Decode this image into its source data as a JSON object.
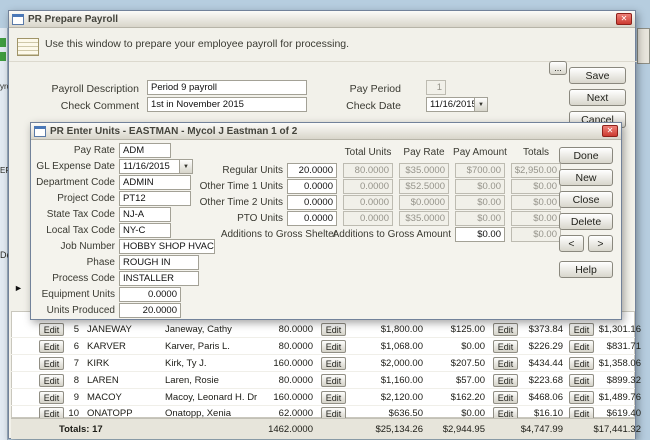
{
  "desktop": {
    "fragments": {
      "text1": "yroll",
      "text2": "EFTI",
      "text3": "Dep"
    }
  },
  "prepare_window": {
    "title": "PR Prepare Payroll",
    "instruction": "Use this window to prepare your employee payroll for processing.",
    "ellipsis_button": "...",
    "fields": {
      "payroll_description": {
        "label": "Payroll Description",
        "value": "Period 9 payroll"
      },
      "check_comment": {
        "label": "Check Comment",
        "value": "1st in November 2015"
      },
      "pay_period": {
        "label": "Pay Period",
        "value": "1"
      },
      "check_date": {
        "label": "Check Date",
        "value": "11/16/2015"
      }
    },
    "buttons": {
      "save": "Save",
      "next": "Next",
      "cancel": "Cancel"
    },
    "grid": {
      "edit_label": "Edit",
      "rows": [
        {
          "num": "5",
          "code": "JANEWAY",
          "name": "Janeway, Cathy",
          "hours": "80.0000",
          "amount1": "$1,800.00",
          "amount2": "$125.00",
          "amount3": "$373.84",
          "amount4": "$1,301.16"
        },
        {
          "num": "6",
          "code": "KARVER",
          "name": "Karver, Paris L.",
          "hours": "80.0000",
          "amount1": "$1,068.00",
          "amount2": "$0.00",
          "amount3": "$226.29",
          "amount4": "$831.71"
        },
        {
          "num": "7",
          "code": "KIRK",
          "name": "Kirk, Ty J.",
          "hours": "160.0000",
          "amount1": "$2,000.00",
          "amount2": "$207.50",
          "amount3": "$434.44",
          "amount4": "$1,358.06"
        },
        {
          "num": "8",
          "code": "LAREN",
          "name": "Laren, Rosie",
          "hours": "80.0000",
          "amount1": "$1,160.00",
          "amount2": "$57.00",
          "amount3": "$223.68",
          "amount4": "$899.32"
        },
        {
          "num": "9",
          "code": "MACOY",
          "name": "Macoy, Leonard H. Dr",
          "hours": "160.0000",
          "amount1": "$2,120.00",
          "amount2": "$162.20",
          "amount3": "$468.06",
          "amount4": "$1,489.76"
        },
        {
          "num": "10",
          "code": "ONATOPP",
          "name": "Onatopp, Xenia",
          "hours": "62.0000",
          "amount1": "$636.50",
          "amount2": "$0.00",
          "amount3": "$16.10",
          "amount4": "$619.40"
        }
      ],
      "totals": {
        "label": "Totals: 17",
        "hours": "1462.0000",
        "amount1": "$25,134.26",
        "amount2": "$2,944.95",
        "amount3": "$4,747.99",
        "amount4": "$17,441.32"
      }
    }
  },
  "units_dialog": {
    "title": "PR Enter Units - EASTMAN - Mycol J Eastman 1 of 2",
    "left_fields": {
      "pay_rate": {
        "label": "Pay Rate",
        "value": "ADM"
      },
      "gl_expense_date": {
        "label": "GL Expense Date",
        "value": "11/16/2015"
      },
      "department_code": {
        "label": "Department Code",
        "value": "ADMIN"
      },
      "project_code": {
        "label": "Project Code",
        "value": "PT12"
      },
      "state_tax_code": {
        "label": "State Tax Code",
        "value": "NJ-A"
      },
      "local_tax_code": {
        "label": "Local Tax Code",
        "value": "NY-C"
      },
      "job_number": {
        "label": "Job Number",
        "value": "HOBBY SHOP HVAC"
      },
      "phase": {
        "label": "Phase",
        "value": "ROUGH IN"
      },
      "process_code": {
        "label": "Process Code",
        "value": "INSTALLER"
      },
      "equipment_units": {
        "label": "Equipment Units",
        "value": "0.0000"
      },
      "units_produced": {
        "label": "Units Produced",
        "value": "20.0000"
      }
    },
    "columns": {
      "total_units": "Total Units",
      "pay_rate": "Pay Rate",
      "pay_amount": "Pay Amount",
      "totals": "Totals"
    },
    "unit_rows": [
      {
        "label": "Regular Units",
        "units": "20.0000",
        "total_units": "80.0000",
        "pay_rate": "$35.0000",
        "pay_amount": "$700.00",
        "totals": "$2,950.00"
      },
      {
        "label": "Other Time 1 Units",
        "units": "0.0000",
        "total_units": "0.0000",
        "pay_rate": "$52.5000",
        "pay_amount": "$0.00",
        "totals": "$0.00"
      },
      {
        "label": "Other Time 2 Units",
        "units": "0.0000",
        "total_units": "0.0000",
        "pay_rate": "$0.0000",
        "pay_amount": "$0.00",
        "totals": "$0.00"
      },
      {
        "label": "PTO Units",
        "units": "0.0000",
        "total_units": "0.0000",
        "pay_rate": "$35.0000",
        "pay_amount": "$0.00",
        "totals": "$0.00"
      }
    ],
    "additions": {
      "label": "Additions to Gross Shelter",
      "amount_label": "Additions to Gross Amount",
      "amount": "$0.00",
      "total": "$0.00"
    },
    "buttons": {
      "done": "Done",
      "new": "New",
      "close": "Close",
      "delete": "Delete",
      "prev": "<",
      "next": ">",
      "help": "Help"
    }
  }
}
